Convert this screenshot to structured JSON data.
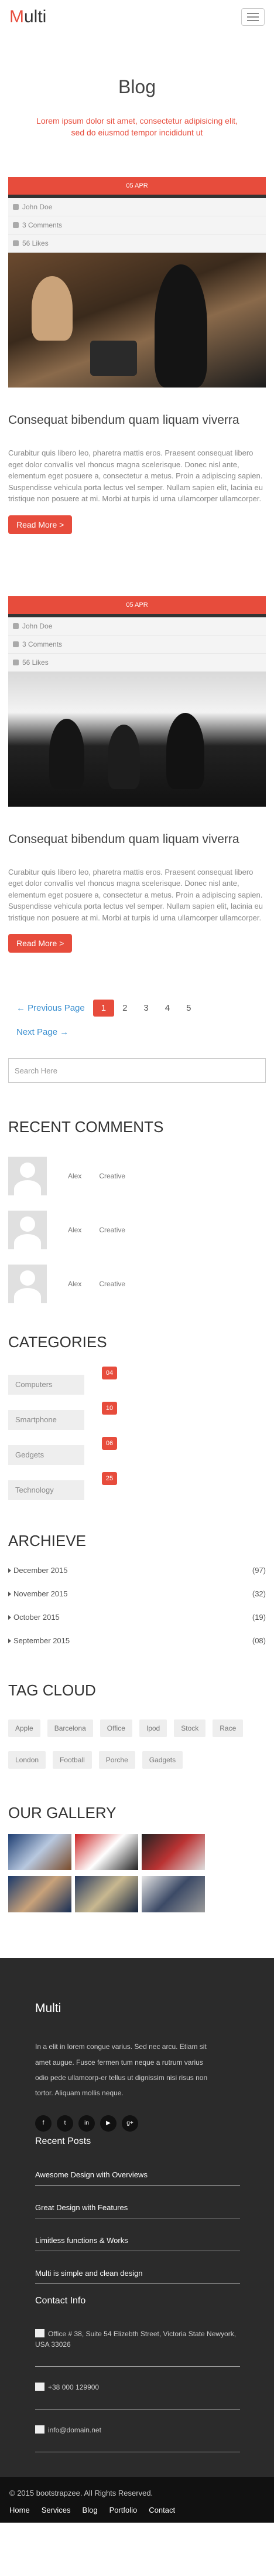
{
  "brand": {
    "first": "M",
    "rest": "ulti"
  },
  "hero": {
    "title": "Blog",
    "subtitle": "Lorem ipsum dolor sit amet, consectetur adipisicing elit, sed do eiusmod tempor incididunt ut"
  },
  "posts": [
    {
      "date": "05 APR",
      "author": "John Doe",
      "comments": "3 Comments",
      "likes": "56 Likes",
      "title": "Consequat bibendum quam liquam viverra",
      "excerpt": "Curabitur quis libero leo, pharetra mattis eros. Praesent consequat libero eget dolor convallis vel rhoncus magna scelerisque. Donec nisl ante, elementum eget posuere a, consectetur a metus. Proin a adipiscing sapien. Suspendisse vehicula porta lectus vel semper. Nullam sapien elit, lacinia eu tristique non posuere at mi. Morbi at turpis id urna ullamcorper ullamcorper.",
      "button": "Read More >"
    },
    {
      "date": "05 APR",
      "author": "John Doe",
      "comments": "3 Comments",
      "likes": "56 Likes",
      "title": "Consequat bibendum quam liquam viverra",
      "excerpt": "Curabitur quis libero leo, pharetra mattis eros. Praesent consequat libero eget dolor convallis vel rhoncus magna scelerisque. Donec nisl ante, elementum eget posuere a, consectetur a metus. Proin a adipiscing sapien. Suspendisse vehicula porta lectus vel semper. Nullam sapien elit, lacinia eu tristique non posuere at mi. Morbi at turpis id urna ullamcorper ullamcorper.",
      "button": "Read More >"
    }
  ],
  "pagination": {
    "prev": "← Previous Page",
    "pages": [
      "1",
      "2",
      "3",
      "4",
      "5"
    ],
    "next": "Next Page →",
    "active": "1"
  },
  "search": {
    "placeholder": "Search Here"
  },
  "recent_comments": {
    "title": "Recent Comments",
    "items": [
      {
        "who": "Alex",
        "what": "Creative"
      },
      {
        "who": "Alex",
        "what": "Creative"
      },
      {
        "who": "Alex",
        "what": "Creative"
      }
    ]
  },
  "categories": {
    "title": "Categories",
    "items": [
      {
        "name": "Computers",
        "count": "04"
      },
      {
        "name": "Smartphone",
        "count": "10"
      },
      {
        "name": "Gedgets",
        "count": "06"
      },
      {
        "name": "Technology",
        "count": "25"
      }
    ]
  },
  "archieve": {
    "title": "Archieve",
    "items": [
      {
        "month": "December 2015",
        "count": "(97)"
      },
      {
        "month": "November 2015",
        "count": "(32)"
      },
      {
        "month": "October 2015",
        "count": "(19)"
      },
      {
        "month": "September 2015",
        "count": "(08)"
      }
    ]
  },
  "tag_cloud": {
    "title": "Tag Cloud",
    "tags": [
      "Apple",
      "Barcelona",
      "Office",
      "Ipod",
      "Stock",
      "Race",
      "London",
      "Football",
      "Porche",
      "Gadgets"
    ]
  },
  "gallery": {
    "title": "Our Gallery"
  },
  "footer": {
    "brand": "Multi",
    "description": "In a elit in lorem congue varius. Sed nec arcu. Etiam sit amet augue. Fusce fermen tum neque a rutrum varius odio pede ullamcorp-er tellus ut dignissim nisi risus non tortor. Aliquam mollis neque.",
    "social": [
      "f",
      "t",
      "in",
      "▶",
      "g+"
    ],
    "recent_posts_title": "Recent Posts",
    "recent_posts": [
      "Awesome Design with Overviews",
      "Great Design with Features",
      "Limitless functions & Works",
      "Multi is simple and clean design"
    ],
    "contact_title": "Contact Info",
    "address": "Office # 38, Suite 54 Elizebth Street, Victoria State Newyork, USA 33026",
    "phone": "+38 000 129900",
    "email": "info@domain.net",
    "copyright": "© 2015 bootstrapzee. All Rights Reserved.",
    "nav": [
      "Home",
      "Services",
      "Blog",
      "Portfolio",
      "Contact"
    ]
  }
}
